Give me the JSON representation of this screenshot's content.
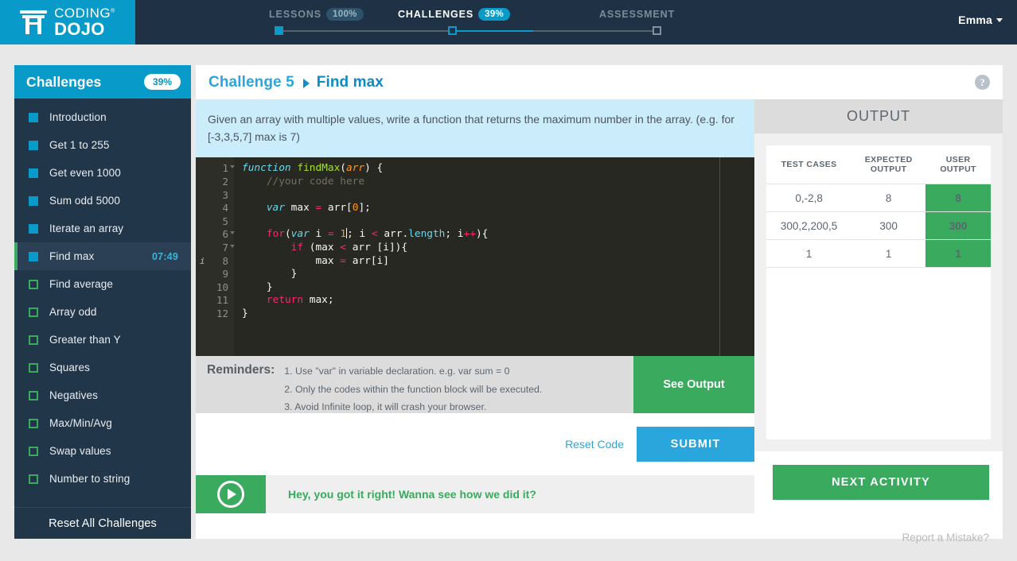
{
  "topbar": {
    "logo": {
      "line1": "CODING",
      "trademark": "®",
      "line2": "DOJO",
      "icon": "torii-gate-icon"
    },
    "steps": [
      {
        "label": "LESSONS",
        "percent": "100%",
        "state": "complete"
      },
      {
        "label": "CHALLENGES",
        "percent": "39%",
        "state": "current"
      },
      {
        "label": "ASSESSMENT",
        "percent": "",
        "state": "locked"
      }
    ],
    "user": {
      "name": "Emma",
      "caret_icon": "chevron-down-icon"
    }
  },
  "sidebar": {
    "title": "Challenges",
    "percent": "39%",
    "items": [
      {
        "label": "Introduction",
        "done": true,
        "active": false,
        "time": ""
      },
      {
        "label": "Get 1 to 255",
        "done": true,
        "active": false,
        "time": ""
      },
      {
        "label": "Get even 1000",
        "done": true,
        "active": false,
        "time": ""
      },
      {
        "label": "Sum odd 5000",
        "done": true,
        "active": false,
        "time": ""
      },
      {
        "label": "Iterate an array",
        "done": true,
        "active": false,
        "time": ""
      },
      {
        "label": "Find max",
        "done": true,
        "active": true,
        "time": "07:49"
      },
      {
        "label": "Find average",
        "done": false,
        "active": false,
        "time": ""
      },
      {
        "label": "Array odd",
        "done": false,
        "active": false,
        "time": ""
      },
      {
        "label": "Greater than Y",
        "done": false,
        "active": false,
        "time": ""
      },
      {
        "label": "Squares",
        "done": false,
        "active": false,
        "time": ""
      },
      {
        "label": "Negatives",
        "done": false,
        "active": false,
        "time": ""
      },
      {
        "label": "Max/Min/Avg",
        "done": false,
        "active": false,
        "time": ""
      },
      {
        "label": "Swap values",
        "done": false,
        "active": false,
        "time": ""
      },
      {
        "label": "Number to string",
        "done": false,
        "active": false,
        "time": ""
      }
    ],
    "footer": "Reset All Challenges"
  },
  "main": {
    "breadcrumb_challenge": "Challenge 5",
    "breadcrumb_name": "Find max",
    "help_icon_glyph": "?",
    "instructions": "Given an array with multiple values, write a function that returns the maximum number in the array. (e.g. for [-3,3,5,7] max is 7)"
  },
  "editor": {
    "line_numbers": [
      "1",
      "2",
      "3",
      "4",
      "5",
      "6",
      "7",
      "8",
      "9",
      "10",
      "11",
      "12"
    ],
    "fold_lines": [
      1,
      6,
      7
    ],
    "info_marker_line": 8,
    "code_lines": [
      "function findMax(arr) {",
      "    //your code here",
      "",
      "    var max = arr[0];",
      "",
      "    for(var i = 1; i < arr.length; i++){",
      "        if (max < arr [i]){",
      "            max = arr[i]",
      "        }",
      "    }",
      "    return max;",
      "}"
    ]
  },
  "reminders": {
    "title": "Reminders:",
    "lines": [
      "1. Use \"var\" in variable declaration. e.g. var sum = 0",
      "2. Only the codes within the function block will be executed.",
      "3. Avoid Infinite loop, it will crash your browser."
    ],
    "see_output_label": "See Output"
  },
  "actions": {
    "reset_code": "Reset Code",
    "submit": "SUBMIT",
    "next_activity": "NEXT ACTIVITY"
  },
  "success": {
    "play_icon": "play-circle-icon",
    "message": "Hey, you got it right! Wanna see how we did it?"
  },
  "output": {
    "title": "OUTPUT",
    "columns": [
      "TEST CASES",
      "EXPECTED OUTPUT",
      "USER OUTPUT"
    ],
    "rows": [
      {
        "test": "0,-2,8",
        "expected": "8",
        "user": "8",
        "pass": true
      },
      {
        "test": "300,2,200,5",
        "expected": "300",
        "user": "300",
        "pass": true
      },
      {
        "test": "1",
        "expected": "1",
        "user": "1",
        "pass": true
      }
    ]
  },
  "footer": {
    "report": "Report a Mistake?"
  },
  "colors": {
    "brand_blue": "#089ac8",
    "dark_navy": "#1f3144",
    "sidebar_navy": "#22364a",
    "green": "#3aaa5e",
    "light_blue_banner": "#cbecfa",
    "link_blue": "#2ba6dd"
  }
}
